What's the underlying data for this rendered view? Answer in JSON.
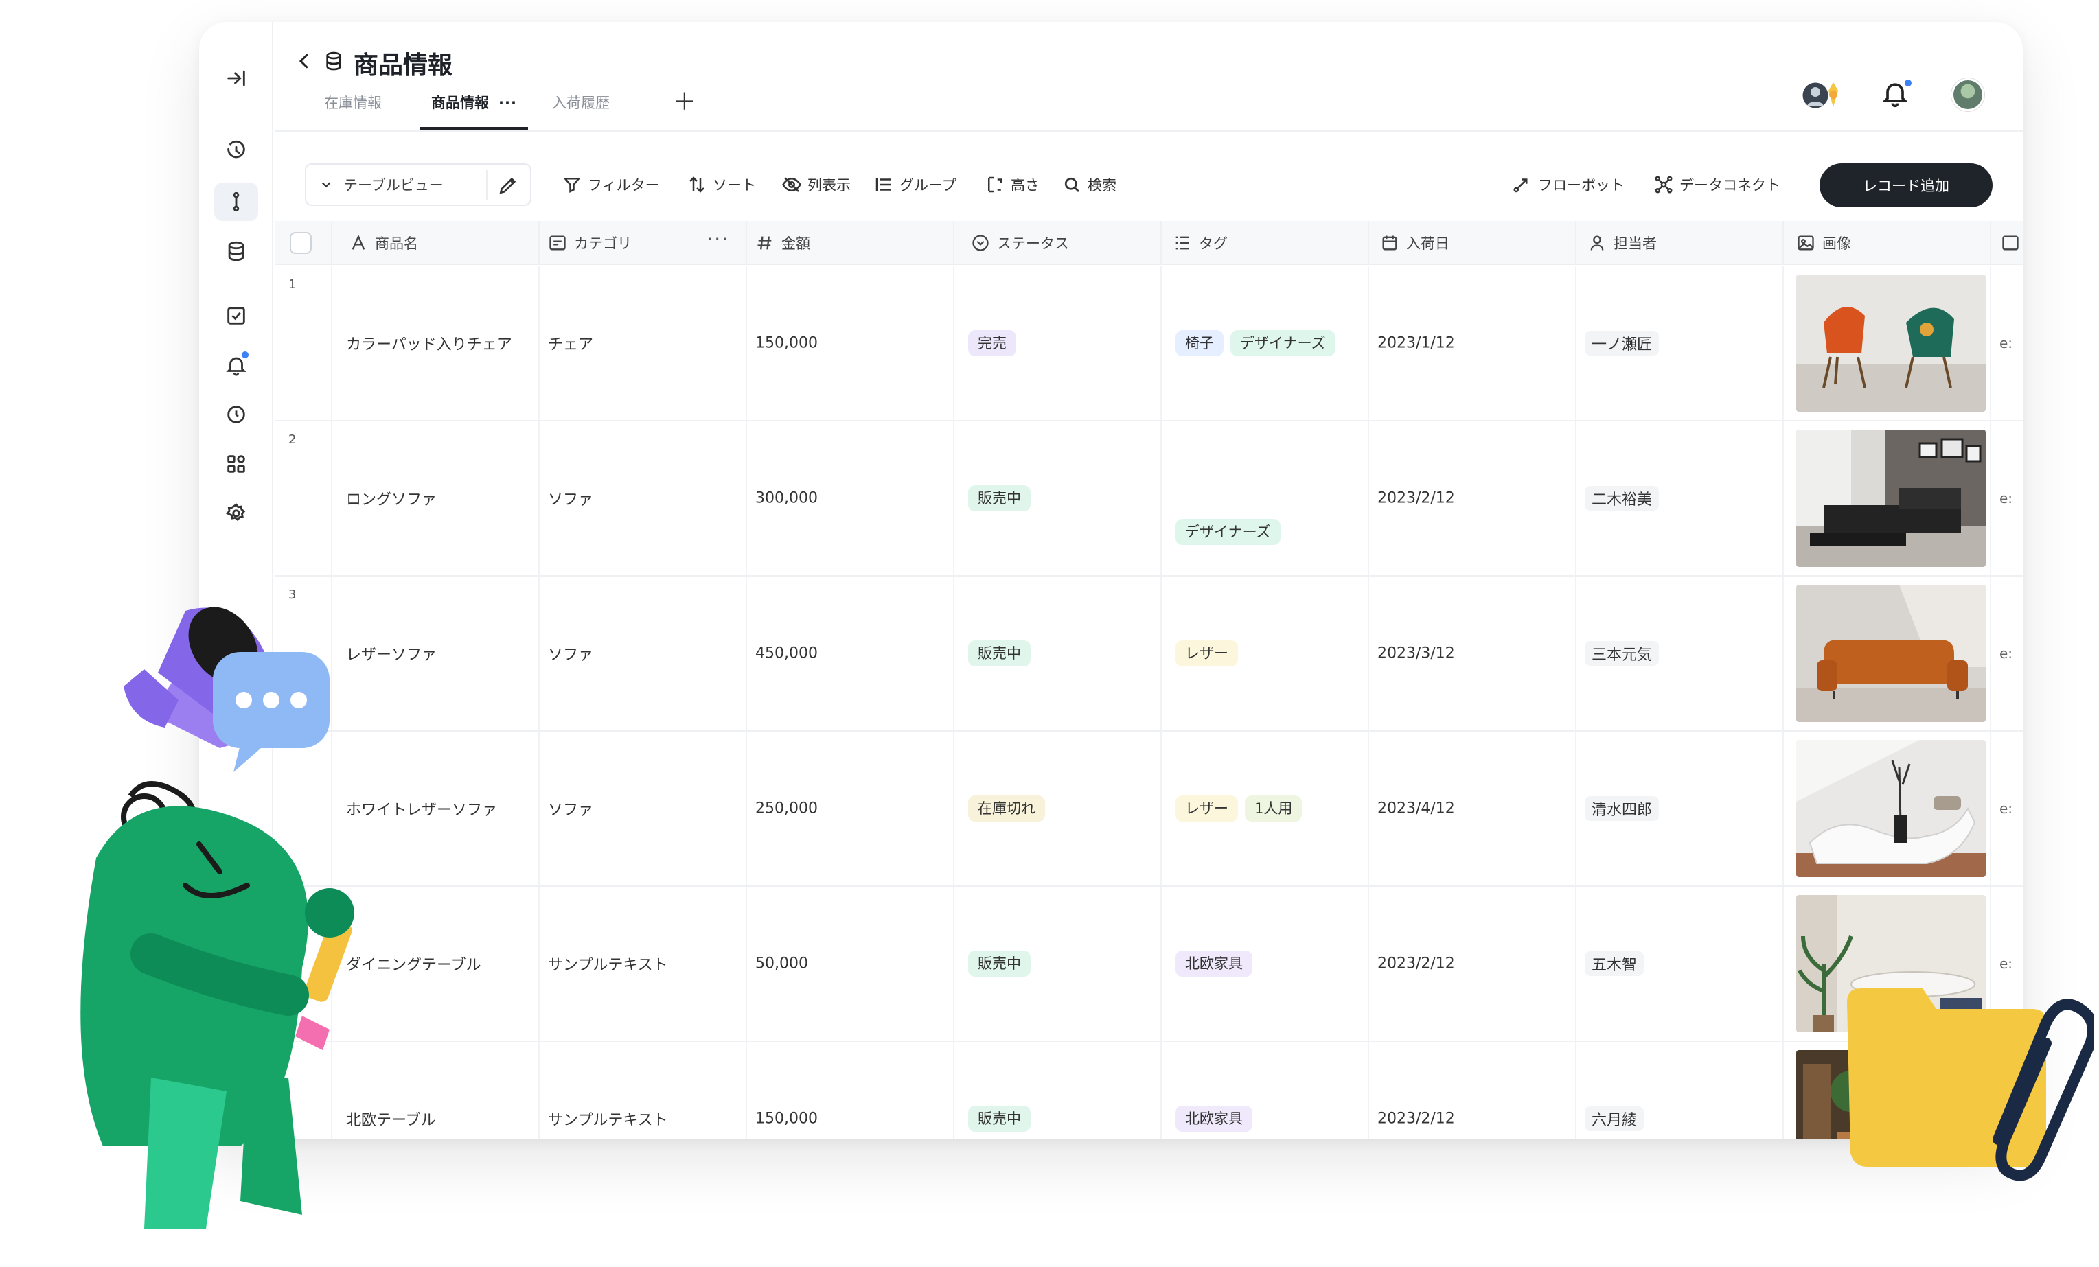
{
  "page": {
    "title": "商品情報",
    "tabs": [
      {
        "label": "在庫情報",
        "active": false
      },
      {
        "label": "商品情報",
        "active": true,
        "more": "···"
      },
      {
        "label": "入荷履歴",
        "active": false
      }
    ],
    "add_tab": "+"
  },
  "toolbar": {
    "view": "テーブルビュー",
    "filter": "フィルター",
    "sort": "ソート",
    "columns": "列表示",
    "group": "グループ",
    "height": "高さ",
    "search": "検索",
    "flowbot": "フローボット",
    "data_connect": "データコネクト",
    "add_record": "レコード追加"
  },
  "table": {
    "headers": {
      "name": "商品名",
      "category": "カテゴリ",
      "price": "金額",
      "status": "ステータス",
      "tags": "タグ",
      "date": "入荷日",
      "owner": "担当者",
      "image": "画像"
    },
    "header_more": "···",
    "cutoff_text": "e:",
    "rows": [
      {
        "num": "1",
        "name": "カラーパッド入りチェア",
        "category": "チェア",
        "price": "150,000",
        "status": "完売",
        "tags": [
          "椅子",
          "デザイナーズ"
        ],
        "date": "2023/1/12",
        "owner": "一ノ瀬匠"
      },
      {
        "num": "2",
        "name": "ロングソファ",
        "category": "ソファ",
        "price": "300,000",
        "status": "販売中",
        "tags": [
          "デザイナーズ"
        ],
        "date": "2023/2/12",
        "owner": "二木裕美"
      },
      {
        "num": "3",
        "name": "レザーソファ",
        "category": "ソファ",
        "price": "450,000",
        "status": "販売中",
        "tags": [
          "レザー"
        ],
        "date": "2023/3/12",
        "owner": "三本元気"
      },
      {
        "num": "",
        "name": "ホワイトレザーソファ",
        "category": "ソファ",
        "price": "250,000",
        "status": "在庫切れ",
        "tags": [
          "レザー",
          "1人用"
        ],
        "date": "2023/4/12",
        "owner": "清水四郎"
      },
      {
        "num": "",
        "name": "ダイニングテーブル",
        "category": "サンプルテキスト",
        "price": "50,000",
        "status": "販売中",
        "tags": [
          "北欧家具"
        ],
        "date": "2023/2/12",
        "owner": "五木智"
      },
      {
        "num": "",
        "name": "北欧テーブル",
        "category": "サンプルテキスト",
        "price": "150,000",
        "status": "販売中",
        "tags": [
          "北欧家具"
        ],
        "date": "2023/2/12",
        "owner": "六月綾"
      }
    ]
  },
  "colors": {
    "primary_button": "#1f242b",
    "status_sold_out": "#ede7fb",
    "status_selling": "#e0f5ec",
    "status_out_of_stock": "#f7f2d9",
    "tag_blue": "#e5efff",
    "tag_green": "#dff6ec",
    "tag_yellow": "#fbf6dc",
    "tag_purple": "#efe9fb"
  }
}
